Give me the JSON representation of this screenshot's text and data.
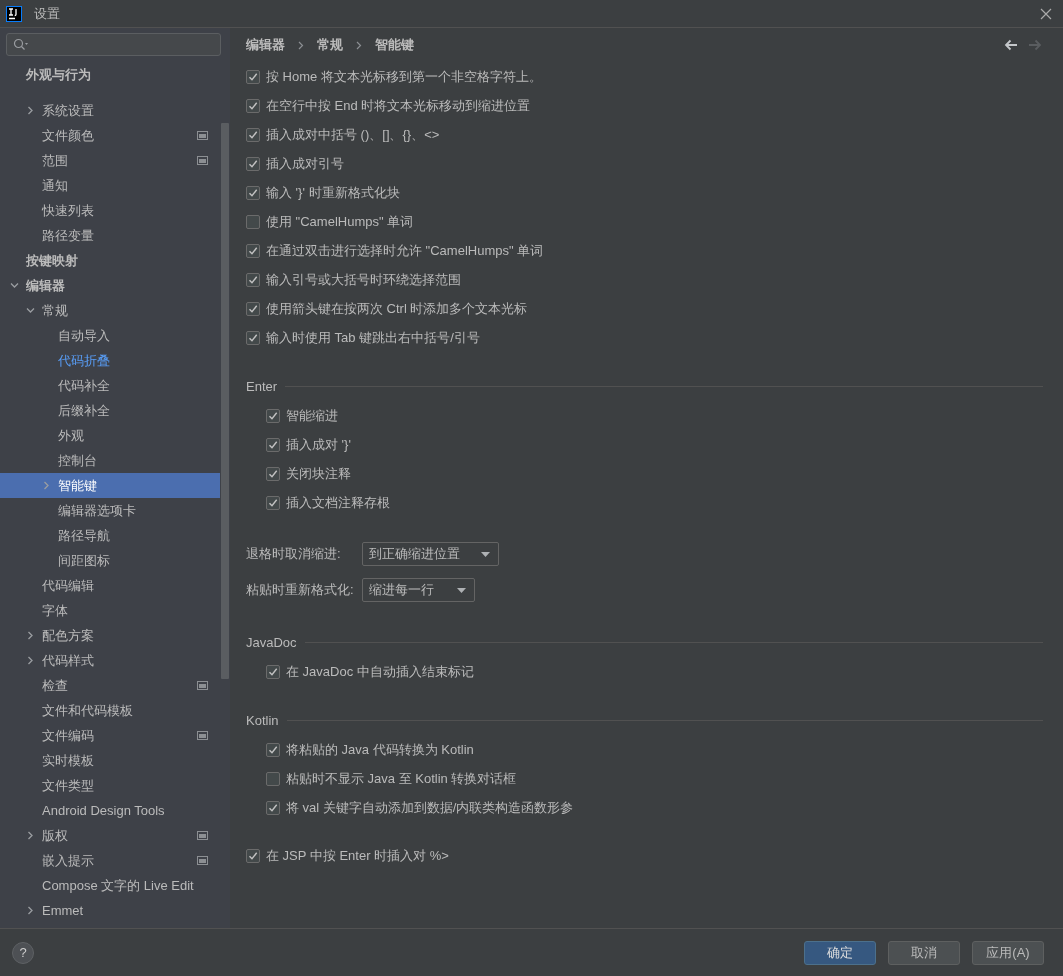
{
  "window": {
    "title": "设置"
  },
  "sidebar": {
    "items": [
      {
        "label": "外观与行为",
        "selected": false,
        "modified": false,
        "project_scope": false,
        "children": [
          {
            "label": "系统设置",
            "selected": false,
            "modified": false,
            "project_scope": false,
            "expanded": false
          },
          {
            "label": "文件颜色",
            "selected": false,
            "modified": false,
            "project_scope": true
          },
          {
            "label": "范围",
            "selected": false,
            "modified": false,
            "project_scope": true
          },
          {
            "label": "通知",
            "selected": false,
            "modified": false,
            "project_scope": false
          },
          {
            "label": "快速列表",
            "selected": false,
            "modified": false,
            "project_scope": false
          },
          {
            "label": "路径变量",
            "selected": false,
            "modified": false,
            "project_scope": false
          }
        ]
      },
      {
        "label": "按键映射",
        "selected": false,
        "modified": false,
        "project_scope": false
      },
      {
        "label": "编辑器",
        "selected": false,
        "modified": false,
        "project_scope": false,
        "expanded": true,
        "children": [
          {
            "label": "常规",
            "selected": false,
            "modified": false,
            "project_scope": false,
            "expanded": true,
            "children": [
              {
                "label": "自动导入",
                "selected": false,
                "modified": false,
                "project_scope": false
              },
              {
                "label": "代码折叠",
                "selected": false,
                "modified": true,
                "project_scope": false
              },
              {
                "label": "代码补全",
                "selected": false,
                "modified": false,
                "project_scope": false
              },
              {
                "label": "后缀补全",
                "selected": false,
                "modified": false,
                "project_scope": false
              },
              {
                "label": "外观",
                "selected": false,
                "modified": false,
                "project_scope": false
              },
              {
                "label": "控制台",
                "selected": false,
                "modified": false,
                "project_scope": false
              },
              {
                "label": "智能键",
                "selected": true,
                "modified": false,
                "project_scope": false,
                "expanded": false
              },
              {
                "label": "编辑器选项卡",
                "selected": false,
                "modified": false,
                "project_scope": false
              },
              {
                "label": "路径导航",
                "selected": false,
                "modified": false,
                "project_scope": false
              },
              {
                "label": "间距图标",
                "selected": false,
                "modified": false,
                "project_scope": false
              }
            ]
          },
          {
            "label": "代码编辑",
            "selected": false,
            "modified": false,
            "project_scope": false
          },
          {
            "label": "字体",
            "selected": false,
            "modified": false,
            "project_scope": false
          },
          {
            "label": "配色方案",
            "selected": false,
            "modified": false,
            "project_scope": false,
            "expanded": false
          },
          {
            "label": "代码样式",
            "selected": false,
            "modified": false,
            "project_scope": false,
            "expanded": false
          },
          {
            "label": "检查",
            "selected": false,
            "modified": false,
            "project_scope": true
          },
          {
            "label": "文件和代码模板",
            "selected": false,
            "modified": false,
            "project_scope": false
          },
          {
            "label": "文件编码",
            "selected": false,
            "modified": false,
            "project_scope": true
          },
          {
            "label": "实时模板",
            "selected": false,
            "modified": false,
            "project_scope": false
          },
          {
            "label": "文件类型",
            "selected": false,
            "modified": false,
            "project_scope": false
          },
          {
            "label": "Android Design Tools",
            "selected": false,
            "modified": false,
            "project_scope": false
          },
          {
            "label": "版权",
            "selected": false,
            "modified": false,
            "project_scope": true,
            "expanded": false
          },
          {
            "label": "嵌入提示",
            "selected": false,
            "modified": false,
            "project_scope": true
          },
          {
            "label": "Compose 文字的 Live Edit",
            "selected": false,
            "modified": false,
            "project_scope": false
          },
          {
            "label": "Emmet",
            "selected": false,
            "modified": false,
            "project_scope": false,
            "expanded": false
          }
        ]
      }
    ]
  },
  "breadcrumb": [
    "编辑器",
    "常规",
    "智能键"
  ],
  "navigation": {
    "back": {
      "disabled": false
    },
    "forward": {
      "disabled": true
    }
  },
  "groups": [
    {
      "items": [
        {
          "kind": "checkbox",
          "label": "按 Home 将文本光标移到第一个非空格字符上。",
          "checked": true
        },
        {
          "kind": "checkbox",
          "label": "在空行中按 End 时将文本光标移动到缩进位置",
          "checked": true
        },
        {
          "kind": "checkbox",
          "label": "插入成对中括号 ()、[]、{}、<>",
          "checked": true
        },
        {
          "kind": "checkbox",
          "label": "插入成对引号",
          "checked": true
        },
        {
          "kind": "checkbox",
          "label": "输入 '}' 时重新格式化块",
          "checked": true
        },
        {
          "kind": "checkbox",
          "label": "使用 \"CamelHumps\" 单词",
          "checked": false
        },
        {
          "kind": "checkbox",
          "label": "在通过双击进行选择时允许 \"CamelHumps\" 单词",
          "checked": true
        },
        {
          "kind": "checkbox",
          "label": "输入引号或大括号时环绕选择范围",
          "checked": true
        },
        {
          "kind": "checkbox",
          "label": "使用箭头键在按两次 Ctrl 时添加多个文本光标",
          "checked": true
        },
        {
          "kind": "checkbox",
          "label": "输入时使用 Tab 键跳出右中括号/引号",
          "checked": true
        }
      ]
    },
    {
      "title": "Enter",
      "items": [
        {
          "kind": "checkbox",
          "label": "智能缩进",
          "checked": true
        },
        {
          "kind": "checkbox",
          "label": "插入成对 '}'",
          "checked": true
        },
        {
          "kind": "checkbox",
          "label": "关闭块注释",
          "checked": true
        },
        {
          "kind": "checkbox",
          "label": "插入文档注释存根",
          "checked": true
        }
      ]
    },
    {
      "items": [
        {
          "kind": "dropdown",
          "label": "退格时取消缩进:",
          "value": "到正确缩进位置"
        },
        {
          "kind": "dropdown",
          "label": "粘贴时重新格式化:",
          "value": "缩进每一行"
        }
      ]
    },
    {
      "title": "JavaDoc",
      "items": [
        {
          "kind": "checkbox",
          "label": "在 JavaDoc 中自动插入结束标记",
          "checked": true
        }
      ]
    },
    {
      "title": "Kotlin",
      "items": [
        {
          "kind": "checkbox",
          "label": "将粘贴的 Java 代码转换为 Kotlin",
          "checked": true
        },
        {
          "kind": "checkbox",
          "label": "粘贴时不显示 Java 至 Kotlin 转换对话框",
          "checked": false
        },
        {
          "kind": "checkbox",
          "label": "将 val 关键字自动添加到数据/内联类构造函数形参",
          "checked": true
        }
      ]
    },
    {
      "items": [
        {
          "kind": "checkbox",
          "label": "在 JSP 中按 Enter 时插入对 %>",
          "checked": true
        }
      ]
    }
  ],
  "footer": {
    "help": "?",
    "buttons": [
      {
        "label": "确定",
        "default": true
      },
      {
        "label": "取消",
        "default": false
      },
      {
        "label": "应用(A)",
        "default": false
      }
    ]
  }
}
